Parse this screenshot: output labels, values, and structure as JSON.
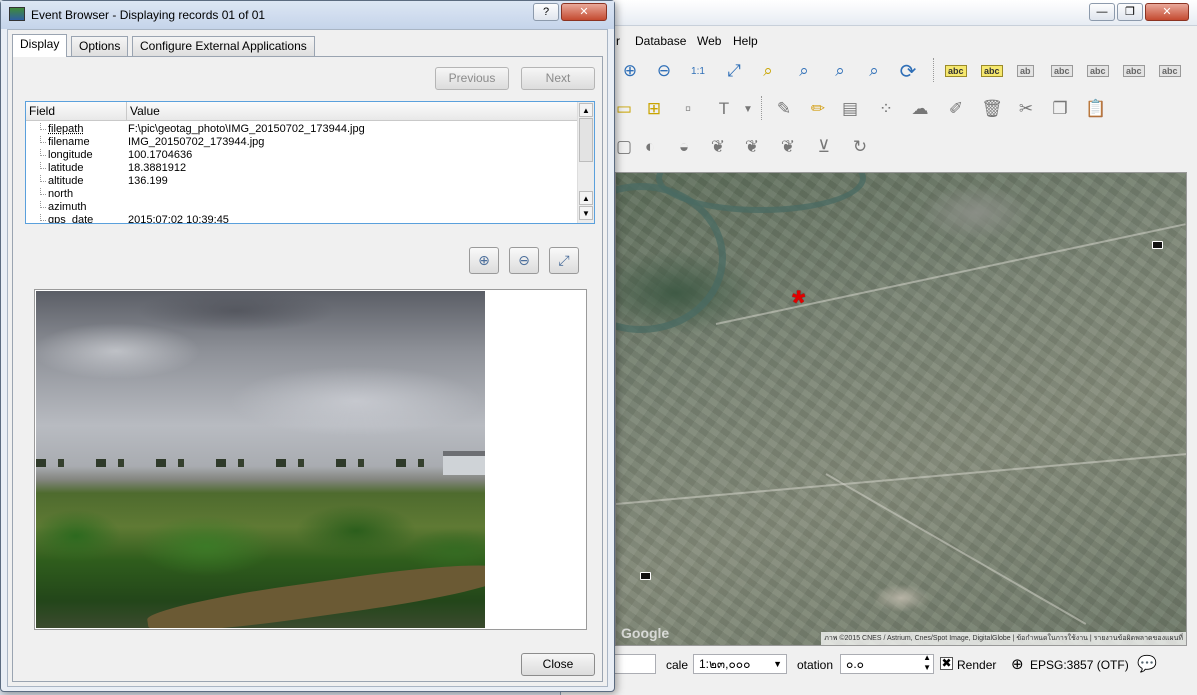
{
  "qgis_window": {
    "menu": [
      "r",
      "Database",
      "Web",
      "Help"
    ],
    "window_controls": [
      "—",
      "❐",
      "✕"
    ],
    "toolbar_icon_names": [
      "zoom-in-icon",
      "zoom-out-icon",
      "zoom-native-icon",
      "zoom-full-icon",
      "zoom-to-selection-icon",
      "zoom-to-layer-icon",
      "zoom-last-icon",
      "zoom-next-icon",
      "refresh-icon"
    ],
    "label_buttons": [
      "abc",
      "abc",
      "ab",
      "abc",
      "abc",
      "abc",
      "abc"
    ],
    "map": {
      "attribution": "ภาพ ©2015 CNES / Astrium, Cnes/Spot Image, DigitalGlobe | ข้อกำหนดในการใช้งาน | รายงานข้อผิดพลาดของแผนที่",
      "google_logo": "Google",
      "marker_symbol": "*",
      "marker_color": "#e10000"
    },
    "status": {
      "coordinate_box": "",
      "scale_label": "cale",
      "scale_value": "1:๒๓,๐๐๐",
      "rotation_label": "otation",
      "rotation_value": "๐.๐",
      "render_checked_glyph": "✖",
      "render_label": "Render",
      "crs": "EPSG:3857 (OTF)"
    }
  },
  "dialog": {
    "title": "Event Browser - Displaying records 01 of 01",
    "help_button": "?",
    "close_button_glyph": "✕",
    "tabs": [
      "Display",
      "Options",
      "Configure External Applications"
    ],
    "active_tab": "Display",
    "previous_button": "Previous",
    "next_button": "Next",
    "table": {
      "headers": [
        "Field",
        "Value"
      ],
      "rows": [
        {
          "field": "filepath",
          "value": "F:\\pic\\geotag_photo\\IMG_20150702_173944.jpg"
        },
        {
          "field": "filename",
          "value": "IMG_20150702_173944.jpg"
        },
        {
          "field": "longitude",
          "value": "100.1704636"
        },
        {
          "field": "latitude",
          "value": "18.3881912"
        },
        {
          "field": "altitude",
          "value": "136.199"
        },
        {
          "field": "north",
          "value": ""
        },
        {
          "field": "azimuth",
          "value": ""
        },
        {
          "field": "gps_date",
          "value": "2015:07:02 10:39:45"
        }
      ]
    },
    "close_label": "Close"
  }
}
